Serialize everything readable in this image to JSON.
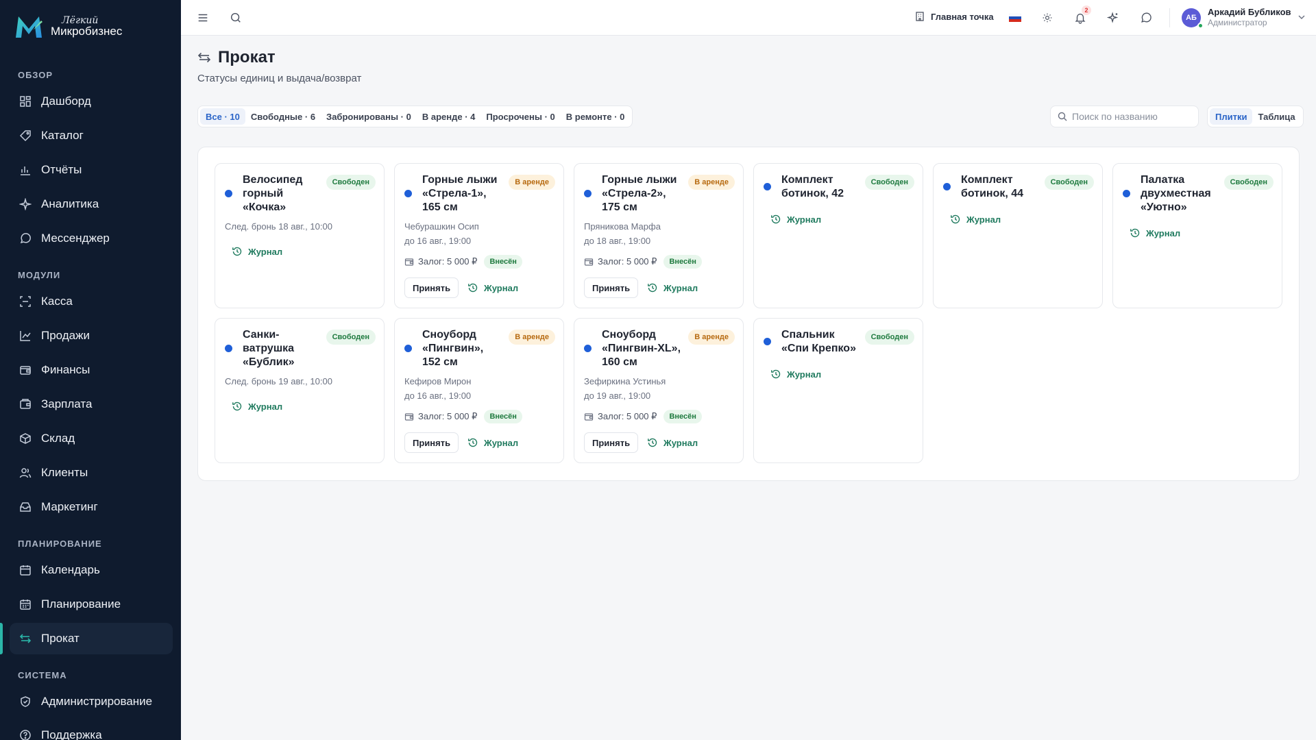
{
  "brand": {
    "sub": "Лёгкий",
    "main": "Микробизнес"
  },
  "sidebar": {
    "sections": [
      {
        "label": "ОБЗОР"
      },
      {
        "label": "МОДУЛИ"
      },
      {
        "label": "ПЛАНИРОВАНИЕ"
      },
      {
        "label": "СИСТЕМА"
      }
    ],
    "items": [
      {
        "label": "Дашборд",
        "icon": "dashboard-icon"
      },
      {
        "label": "Каталог",
        "icon": "catalog-icon"
      },
      {
        "label": "Отчёты",
        "icon": "reports-icon"
      },
      {
        "label": "Аналитика",
        "icon": "analytics-icon"
      },
      {
        "label": "Мессенджер",
        "icon": "messenger-icon"
      },
      {
        "label": "Касса",
        "icon": "cash-register-icon"
      },
      {
        "label": "Продажи",
        "icon": "sales-icon"
      },
      {
        "label": "Финансы",
        "icon": "finance-icon"
      },
      {
        "label": "Зарплата",
        "icon": "salary-icon"
      },
      {
        "label": "Склад",
        "icon": "warehouse-icon"
      },
      {
        "label": "Клиенты",
        "icon": "clients-icon"
      },
      {
        "label": "Маркетинг",
        "icon": "marketing-icon"
      },
      {
        "label": "Календарь",
        "icon": "calendar-icon"
      },
      {
        "label": "Планирование",
        "icon": "planning-icon"
      },
      {
        "label": "Прокат",
        "icon": "rental-icon",
        "active": true
      },
      {
        "label": "Администрирование",
        "icon": "admin-icon"
      },
      {
        "label": "Поддержка",
        "icon": "support-icon"
      }
    ]
  },
  "topbar": {
    "point": "Главная точка",
    "notifications_count": "2",
    "user": {
      "initials": "АБ",
      "name": "Аркадий Бубликов",
      "role": "Администратор"
    }
  },
  "page": {
    "title": "Прокат",
    "subtitle": "Статусы единиц и выдача/возврат"
  },
  "filters": [
    {
      "label": "Все · 10",
      "active": true
    },
    {
      "label": "Свободные · 6"
    },
    {
      "label": "Забронированы · 0"
    },
    {
      "label": "В аренде · 4"
    },
    {
      "label": "Просрочены · 0"
    },
    {
      "label": "В ремонте · 0"
    }
  ],
  "search": {
    "placeholder": "Поиск по названию",
    "value": ""
  },
  "views": [
    {
      "label": "Плитки",
      "active": true
    },
    {
      "label": "Таблица"
    }
  ],
  "labels": {
    "journal": "Журнал",
    "accept": "Принять",
    "paid": "Внесён",
    "status_free": "Свободен",
    "status_rent": "В аренде"
  },
  "colors": {
    "accent": "#1f5fd8",
    "sidebar": "#0f1b2e",
    "link": "#1f7a5e"
  },
  "units": [
    {
      "name": "Велосипед горный «Кочка»",
      "status": "free",
      "line1": "След. бронь 18 авг., 10:00"
    },
    {
      "name": "Горные лыжи «Стрела-1», 165 см",
      "status": "rent",
      "line1": "Чебурашкин Осип",
      "line2": "до 16 авг., 19:00",
      "deposit": "Залог: 5 000 ₽"
    },
    {
      "name": "Горные лыжи «Стрела-2», 175 см",
      "status": "rent",
      "line1": "Пряникова Марфа",
      "line2": "до 18 авг., 19:00",
      "deposit": "Залог: 5 000 ₽"
    },
    {
      "name": "Комплект ботинок, 42",
      "status": "free"
    },
    {
      "name": "Комплект ботинок, 44",
      "status": "free"
    },
    {
      "name": "Палатка двухместная «Уютно»",
      "status": "free"
    },
    {
      "name": "Санки-ватрушка «Бублик»",
      "status": "free",
      "line1": "След. бронь 19 авг., 10:00"
    },
    {
      "name": "Сноуборд «Пингвин», 152 см",
      "status": "rent",
      "line1": "Кефиров Мирон",
      "line2": "до 16 авг., 19:00",
      "deposit": "Залог: 5 000 ₽"
    },
    {
      "name": "Сноуборд «Пингвин-XL», 160 см",
      "status": "rent",
      "line1": "Зефиркина Устинья",
      "line2": "до 19 авг., 19:00",
      "deposit": "Залог: 5 000 ₽"
    },
    {
      "name": "Спальник «Спи Крепко»",
      "status": "free"
    }
  ]
}
